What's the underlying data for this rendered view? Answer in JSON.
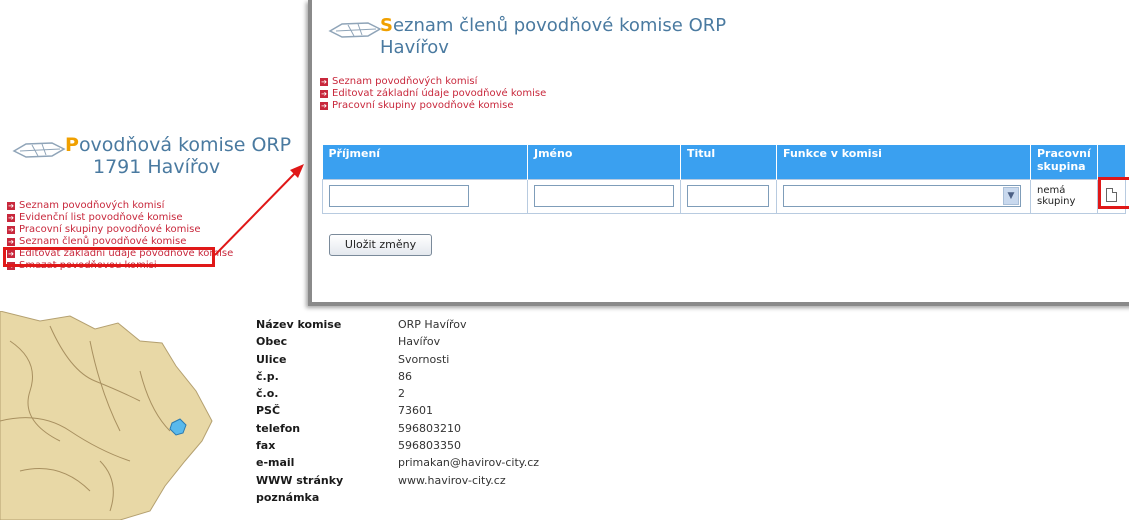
{
  "left_panel": {
    "title_first_letter": "P",
    "title_rest": "ovodňová komise ORP",
    "title_line2": "1791 Havířov",
    "links": [
      "Seznam povodňových komisí",
      "Evidenční list povodňové komise",
      "Pracovní skupiny povodňové komise",
      "Seznam členů povodňové komise",
      "Editovat základní údaje povodňové komise",
      "Smazat povodňovou komisi"
    ]
  },
  "overlay": {
    "title_first_letter": "S",
    "title_rest": "eznam členů povodňové komise ORP",
    "title_line2": "Havířov",
    "links": [
      "Seznam povodňových komisí",
      "Editovat základní údaje povodňové komise",
      "Pracovní skupiny povodňové komise"
    ],
    "table": {
      "headers": [
        "Příjmení",
        "Jméno",
        "Titul",
        "Funkce v komisi",
        "Pracovní skupina"
      ],
      "row": {
        "prijmeni": "",
        "jmeno": "",
        "titul": "",
        "funkce": "",
        "skupina": "nemá skupiny"
      }
    },
    "save_label": "Uložit změny"
  },
  "details": {
    "rows": [
      {
        "label": "Název komise",
        "value": "ORP Havířov"
      },
      {
        "label": "Obec",
        "value": "Havířov"
      },
      {
        "label": "Ulice",
        "value": "Svornosti"
      },
      {
        "label": "č.p.",
        "value": "86"
      },
      {
        "label": "č.o.",
        "value": "2"
      },
      {
        "label": "PSČ",
        "value": "73601"
      },
      {
        "label": "telefon",
        "value": "596803210"
      },
      {
        "label": "fax",
        "value": "596803350"
      },
      {
        "label": "e-mail",
        "value": "primakan@havirov-city.cz"
      },
      {
        "label": "WWW stránky",
        "value": "www.havirov-city.cz"
      },
      {
        "label": "poznámka",
        "value": ""
      }
    ]
  },
  "colors": {
    "accent_blue": "#3aa0f0",
    "title_blue": "#4a7aa0",
    "link_red": "#c8283c",
    "highlight_red": "#e01818",
    "title_orange": "#f0a000"
  },
  "icons": [
    "fish-logo-icon",
    "link-bullet-icon",
    "dropdown-arrow-icon",
    "document-icon",
    "region-map"
  ]
}
